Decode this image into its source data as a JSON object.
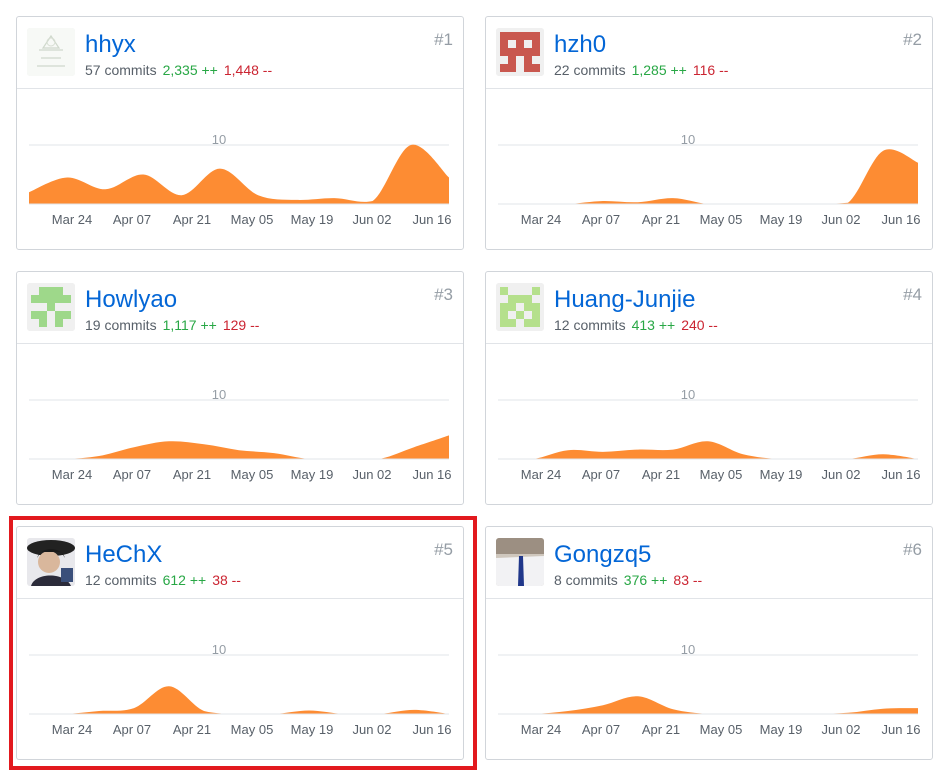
{
  "highlight_color": "#e2191e",
  "chart_color": "#fd8c33",
  "x_ticks": [
    "Mar 24",
    "Apr 07",
    "Apr 21",
    "May 05",
    "May 19",
    "Jun 02",
    "Jun 16"
  ],
  "y_tick": "10",
  "contributors": [
    {
      "name": "hhyx",
      "rank": "#1",
      "commits": "57 commits",
      "additions": "2,335 ++",
      "deletions": "1,448 --",
      "avatar_icon": "sketch-avatar-icon",
      "weekly_commits": [
        2,
        4.5,
        2.5,
        5,
        1.5,
        6,
        1.5,
        0.7,
        1,
        0.5,
        10,
        4.5
      ]
    },
    {
      "name": "hzh0",
      "rank": "#2",
      "commits": "22 commits",
      "additions": "1,285 ++",
      "deletions": "116 --",
      "avatar_icon": "identicon-red-icon",
      "weekly_commits": [
        0,
        0,
        0,
        0.5,
        0.3,
        1,
        0,
        0,
        0,
        0,
        0.2,
        9,
        7
      ]
    },
    {
      "name": "Howlyao",
      "rank": "#3",
      "commits": "19 commits",
      "additions": "1,117 ++",
      "deletions": "129 --",
      "avatar_icon": "identicon-green-icon",
      "weekly_commits": [
        0,
        0,
        0.5,
        2,
        3,
        2.5,
        1.5,
        1,
        0,
        0,
        0,
        2,
        4
      ]
    },
    {
      "name": "Huang-Junjie",
      "rank": "#4",
      "commits": "12 commits",
      "additions": "413 ++",
      "deletions": "240 --",
      "avatar_icon": "identicon-lightgreen-icon",
      "weekly_commits": [
        0,
        0,
        1.5,
        1.2,
        1.6,
        1.6,
        3,
        0.8,
        0,
        0,
        0,
        0.8,
        0
      ]
    },
    {
      "name": "HeChX",
      "rank": "#5",
      "commits": "12 commits",
      "additions": "612 ++",
      "deletions": "38 --",
      "avatar_icon": "photo-avatar-icon",
      "weekly_commits": [
        0,
        0,
        0.5,
        1,
        4.7,
        0.5,
        0,
        0,
        0.6,
        0,
        0,
        0.7,
        0
      ]
    },
    {
      "name": "Gongzq5",
      "rank": "#6",
      "commits": "8 commits",
      "additions": "376 ++",
      "deletions": "83 --",
      "avatar_icon": "photo-avatar-tie-icon",
      "weekly_commits": [
        0,
        0,
        0.5,
        1.5,
        3,
        0.8,
        0,
        0,
        0,
        0,
        0.2,
        0.9,
        1
      ]
    }
  ]
}
